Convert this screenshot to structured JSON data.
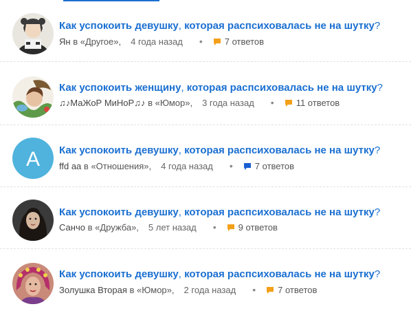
{
  "colors": {
    "link": "#1a6fd1",
    "meta_text": "#555555",
    "answers_icon_orange": "#f4a01a",
    "answers_icon_blue": "#1a5fd1",
    "avatar_letter_bg": "#4fb3dd"
  },
  "questions": [
    {
      "title_before": "Как успокоить девушку",
      "comma": ",",
      "title_after": " которая распсиховалась не на шутку",
      "qmark": "?",
      "author": "Ян",
      "category_text": "в «Другое»,",
      "time": "4 года назад",
      "dot": "•",
      "answers": "7 ответов",
      "icon": "answers-bubble-orange-icon"
    },
    {
      "title_before": "Как успокоить женщину",
      "comma": ",",
      "title_after": " которая распсиховалась не на шутку",
      "qmark": "?",
      "author": "♫♪МаЖоР МиНоР♫♪",
      "category_text": "в «Юмор»,",
      "time": "3 года назад",
      "dot": "•",
      "answers": "11 ответов",
      "icon": "answers-bubble-orange-icon"
    },
    {
      "title_before": "Как успокоить девушку",
      "comma": ",",
      "title_after": " которая распсиховалась не на шутку",
      "qmark": "?",
      "author": "ffd aa",
      "category_text": "в «Отношения»,",
      "time": "4 года назад",
      "dot": "•",
      "answers": "7 ответов",
      "icon": "answers-bubble-blue-icon",
      "avatar_letter": "A"
    },
    {
      "title_before": "Как успокоить девушку",
      "comma": ",",
      "title_after": " которая распсиховалась не на шутку",
      "qmark": "?",
      "author": "Санчо",
      "category_text": "в «Дружба»,",
      "time": "5 лет назад",
      "dot": "•",
      "answers": "9 ответов",
      "icon": "answers-bubble-orange-icon"
    },
    {
      "title_before": "Как успокоить девушку",
      "comma": ",",
      "title_after": " которая распсиховалась не на шутку",
      "qmark": "?",
      "author": "Золушка Вторая",
      "category_text": "в «Юмор»,",
      "time": "2 года назад",
      "dot": "•",
      "answers": "7 ответов",
      "icon": "answers-bubble-orange-icon"
    }
  ]
}
